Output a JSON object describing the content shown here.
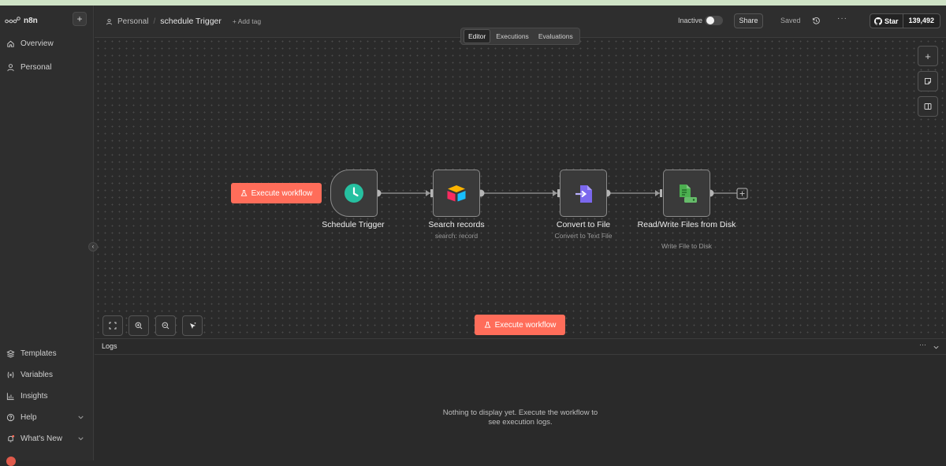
{
  "sidebar": {
    "brand": "n8n",
    "new_label": "+",
    "top_items": [
      {
        "label": "Overview",
        "icon": "home-icon"
      },
      {
        "label": "Personal",
        "icon": "user-icon"
      }
    ],
    "bottom_items": [
      {
        "label": "Templates",
        "icon": "templates-icon"
      },
      {
        "label": "Variables",
        "icon": "variables-icon"
      },
      {
        "label": "Insights",
        "icon": "insights-icon"
      },
      {
        "label": "Help",
        "icon": "help-icon"
      },
      {
        "label": "What's New",
        "icon": "bell-icon"
      }
    ]
  },
  "header": {
    "project": "Personal",
    "workflow_name": "schedule Trigger",
    "add_tag": "+ Add tag",
    "status": "Inactive",
    "share": "Share",
    "saved": "Saved",
    "more": "···",
    "github_star": "Star",
    "github_count": "139,492"
  },
  "tabs": [
    {
      "label": "Editor",
      "active": true
    },
    {
      "label": "Executions",
      "active": false
    },
    {
      "label": "Evaluations",
      "active": false
    }
  ],
  "canvas": {
    "execute_label": "Execute workflow",
    "nodes": [
      {
        "title": "Schedule Trigger",
        "subtitle": "",
        "icon": "clock-icon"
      },
      {
        "title": "Search records",
        "subtitle": "search: record",
        "icon": "airtable-icon"
      },
      {
        "title": "Convert to File",
        "subtitle": "Convert to Text File",
        "icon": "convert-file-icon"
      },
      {
        "title": "Read/Write Files from Disk",
        "subtitle": "Write File to Disk",
        "icon": "disk-file-icon"
      }
    ]
  },
  "logs": {
    "title": "Logs",
    "more": "···",
    "empty_message": "Nothing to display yet. Execute the workflow to see execution logs."
  },
  "colors": {
    "accent": "#ff6d5a",
    "clock_green": "#26c0a0",
    "convert_purple": "#7b68ee",
    "disk_green": "#4caf50"
  }
}
